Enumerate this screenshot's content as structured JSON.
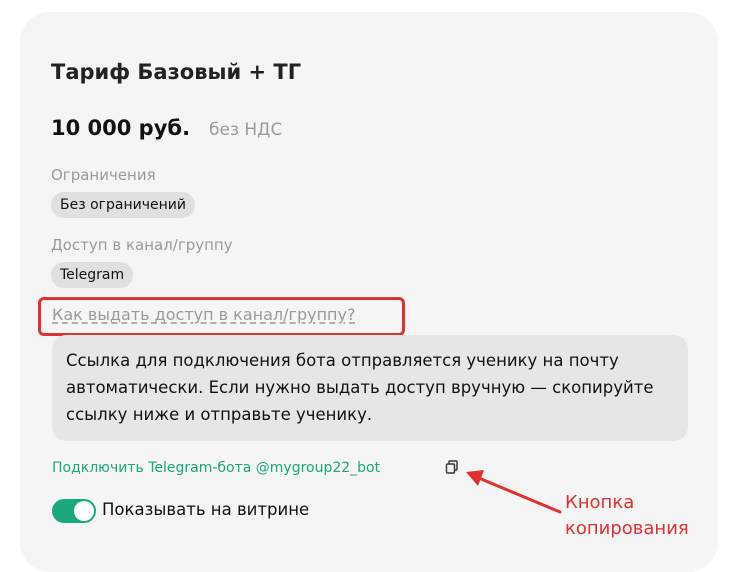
{
  "tariff": {
    "title": "Тариф Базовый + ТГ",
    "price": "10 000 руб.",
    "vat": "без НДС",
    "restrictions_label": "Ограничения",
    "restrictions_value": "Без ограничений",
    "access_label": "Доступ в канал/группу",
    "access_value": "Telegram",
    "help_link": "Как выдать доступ в канал/группу?",
    "info_text": "Ссылка для подключения бота отправляется ученику на почту автоматически. Если нужно выдать доступ вручную — скопируйте ссылку ниже и отправьте ученику.",
    "bot_link": "Подключить Telegram-бота @mygroup22_bot",
    "showcase_label": "Показывать на витрине",
    "showcase_enabled": true
  },
  "annotation": {
    "line1": "Кнопка",
    "line2": "копирования"
  },
  "colors": {
    "accent": "#1aa87c",
    "highlight": "#e03131",
    "card_bg": "#f5f5f5",
    "muted": "#9a9a9a"
  },
  "icons": {
    "copy": "copy-icon"
  }
}
